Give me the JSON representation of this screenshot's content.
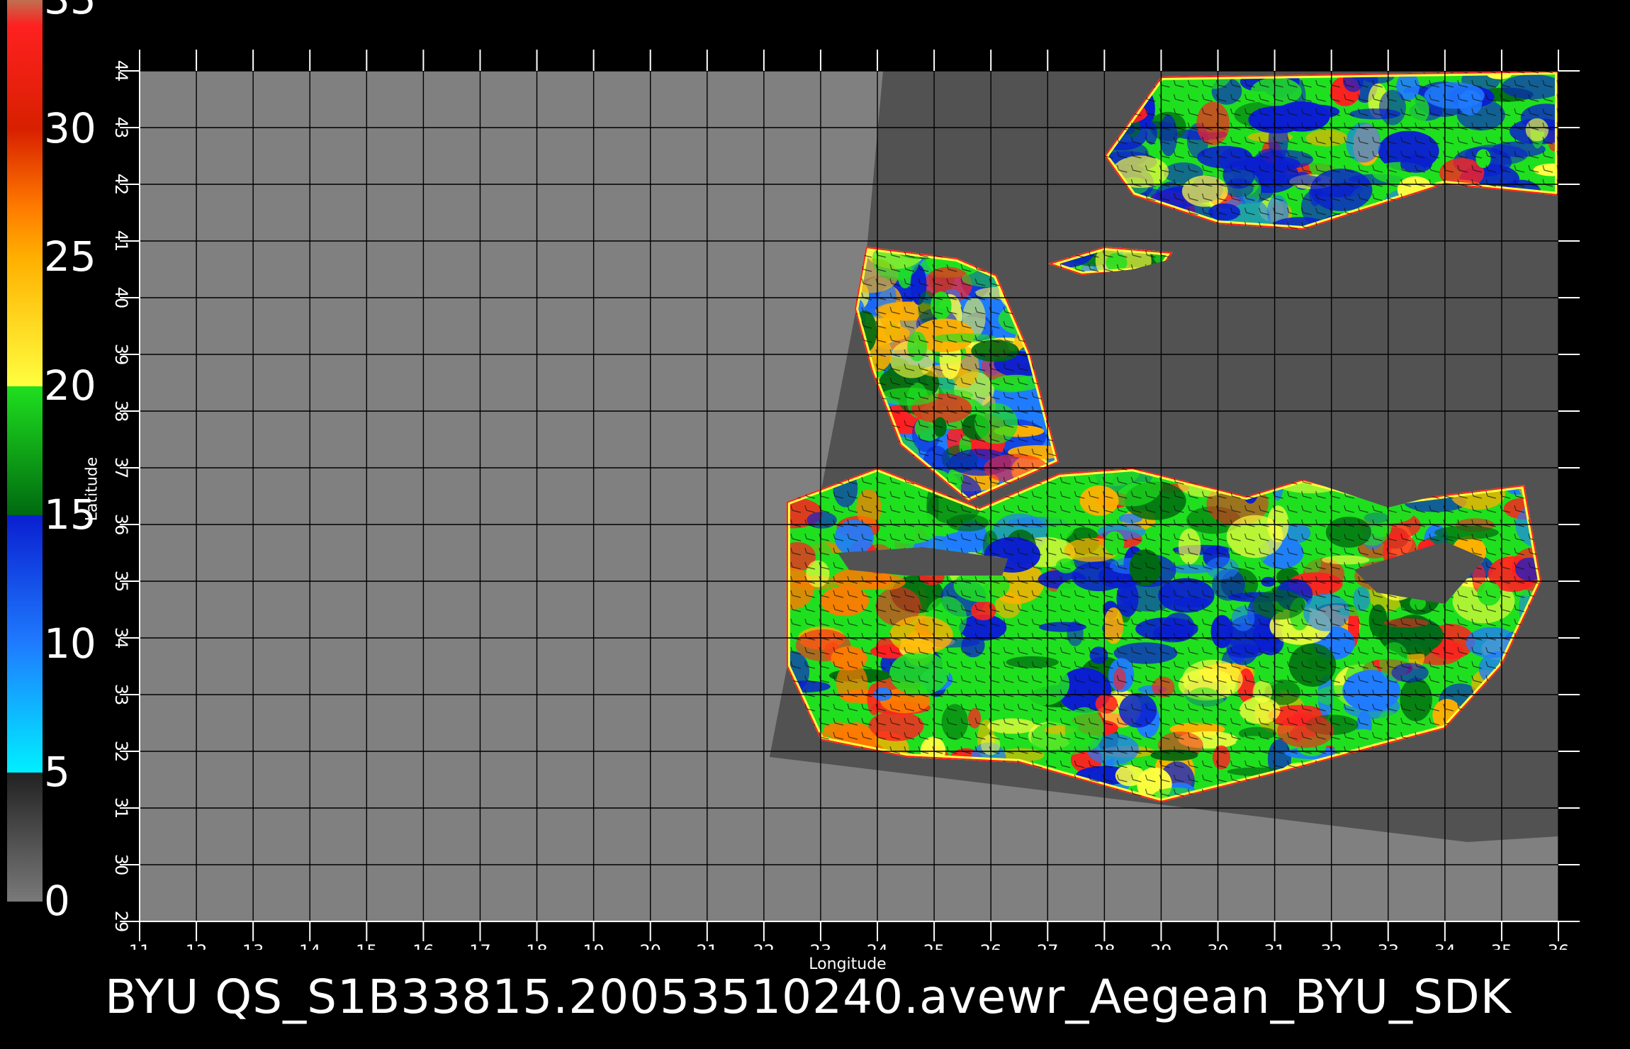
{
  "colorbar": {
    "ticks": [
      "0",
      "5",
      "10",
      "15",
      "20",
      "25",
      "30",
      "35"
    ],
    "stops": [
      {
        "v": 0,
        "color": "#7a7a7a"
      },
      {
        "v": 5,
        "color": "#222222"
      },
      {
        "v": 5.01,
        "color": "#00f0ff"
      },
      {
        "v": 10,
        "color": "#1f7cff"
      },
      {
        "v": 15,
        "color": "#0a1fd0"
      },
      {
        "v": 15.01,
        "color": "#006a10"
      },
      {
        "v": 20,
        "color": "#1fe01f"
      },
      {
        "v": 20.01,
        "color": "#ffff40"
      },
      {
        "v": 25,
        "color": "#ffb000"
      },
      {
        "v": 27,
        "color": "#ff7a00"
      },
      {
        "v": 30,
        "color": "#d82000"
      },
      {
        "v": 34,
        "color": "#ff2020"
      },
      {
        "v": 35,
        "color": "#c07050"
      }
    ]
  },
  "map": {
    "lon_range": [
      11,
      36
    ],
    "lat_range": [
      29,
      44
    ],
    "lon_ticks": [
      "11",
      "12",
      "13",
      "14",
      "15",
      "16",
      "17",
      "18",
      "19",
      "20",
      "21",
      "22",
      "23",
      "24",
      "25",
      "26",
      "27",
      "28",
      "29",
      "30",
      "31",
      "32",
      "33",
      "34",
      "35",
      "36"
    ],
    "lat_ticks": [
      "29",
      "30",
      "31",
      "32",
      "33",
      "34",
      "35",
      "36",
      "37",
      "38",
      "39",
      "40",
      "41",
      "42",
      "43",
      "44"
    ],
    "colors": {
      "background": "#000000",
      "nodata_gray": "#808080",
      "swath_dark": "#525252",
      "grid": "#000000",
      "axis": "#ffffff"
    },
    "swath_corners": [
      [
        24.1,
        44.0
      ],
      [
        36.0,
        44.0
      ],
      [
        36.0,
        30.5
      ],
      [
        34.4,
        30.4
      ],
      [
        22.1,
        31.9
      ],
      [
        23.8,
        40.7
      ]
    ],
    "wind_regions": [
      {
        "name": "southern",
        "poly": [
          [
            22.4,
            36.4
          ],
          [
            24.0,
            37.0
          ],
          [
            25.8,
            36.3
          ],
          [
            27.2,
            36.9
          ],
          [
            28.5,
            37.0
          ],
          [
            30.5,
            36.5
          ],
          [
            31.5,
            36.8
          ],
          [
            33.0,
            36.4
          ],
          [
            35.4,
            36.7
          ],
          [
            35.7,
            35.0
          ],
          [
            35.0,
            33.5
          ],
          [
            34.0,
            32.4
          ],
          [
            31.0,
            31.6
          ],
          [
            29.0,
            31.1
          ],
          [
            26.5,
            31.8
          ],
          [
            24.5,
            31.9
          ],
          [
            23.0,
            32.2
          ],
          [
            22.4,
            33.5
          ]
        ]
      },
      {
        "name": "aegean",
        "poly": [
          [
            23.8,
            40.9
          ],
          [
            25.4,
            40.7
          ],
          [
            26.1,
            40.4
          ],
          [
            26.7,
            39.0
          ],
          [
            27.2,
            37.1
          ],
          [
            25.6,
            36.4
          ],
          [
            24.4,
            37.4
          ],
          [
            23.9,
            38.7
          ],
          [
            23.6,
            39.8
          ]
        ]
      },
      {
        "name": "blacksea",
        "poly": [
          [
            28.0,
            42.5
          ],
          [
            29.0,
            43.9
          ],
          [
            36.0,
            44.0
          ],
          [
            36.0,
            41.8
          ],
          [
            34.0,
            42.0
          ],
          [
            31.5,
            41.2
          ],
          [
            30.0,
            41.3
          ],
          [
            28.5,
            41.8
          ]
        ]
      },
      {
        "name": "marmara",
        "poly": [
          [
            27.0,
            40.6
          ],
          [
            28.0,
            40.9
          ],
          [
            29.2,
            40.8
          ],
          [
            29.0,
            40.5
          ],
          [
            27.6,
            40.4
          ]
        ]
      },
      {
        "name": "cyprus_spot",
        "poly": [
          [
            33.3,
            39.0
          ],
          [
            33.6,
            39.0
          ],
          [
            33.6,
            38.8
          ],
          [
            33.3,
            38.8
          ]
        ]
      }
    ],
    "land_masks": [
      {
        "name": "crete",
        "poly": [
          [
            23.3,
            35.5
          ],
          [
            24.8,
            35.6
          ],
          [
            26.3,
            35.4
          ],
          [
            26.2,
            35.1
          ],
          [
            24.5,
            35.1
          ],
          [
            23.5,
            35.2
          ]
        ]
      },
      {
        "name": "cyprus",
        "poly": [
          [
            32.4,
            35.2
          ],
          [
            34.0,
            35.7
          ],
          [
            34.7,
            35.4
          ],
          [
            34.0,
            34.6
          ],
          [
            32.8,
            34.8
          ]
        ]
      },
      {
        "name": "anatolia",
        "poly": [
          [
            26.8,
            40.3
          ],
          [
            28.5,
            40.5
          ],
          [
            30.0,
            40.9
          ],
          [
            31.5,
            41.0
          ],
          [
            34.0,
            41.8
          ],
          [
            36.0,
            41.8
          ],
          [
            36.0,
            36.7
          ],
          [
            35.0,
            36.8
          ],
          [
            33.0,
            36.3
          ],
          [
            31.5,
            36.8
          ],
          [
            30.5,
            36.5
          ],
          [
            28.5,
            37.0
          ],
          [
            27.4,
            37.3
          ],
          [
            27.0,
            38.5
          ]
        ]
      }
    ],
    "ylabel": "Latitude",
    "xlabel": "Longitude"
  },
  "caption": "BYU  QS_S1B33815.20053510240.avewr_Aegean_BYU_SDK"
}
